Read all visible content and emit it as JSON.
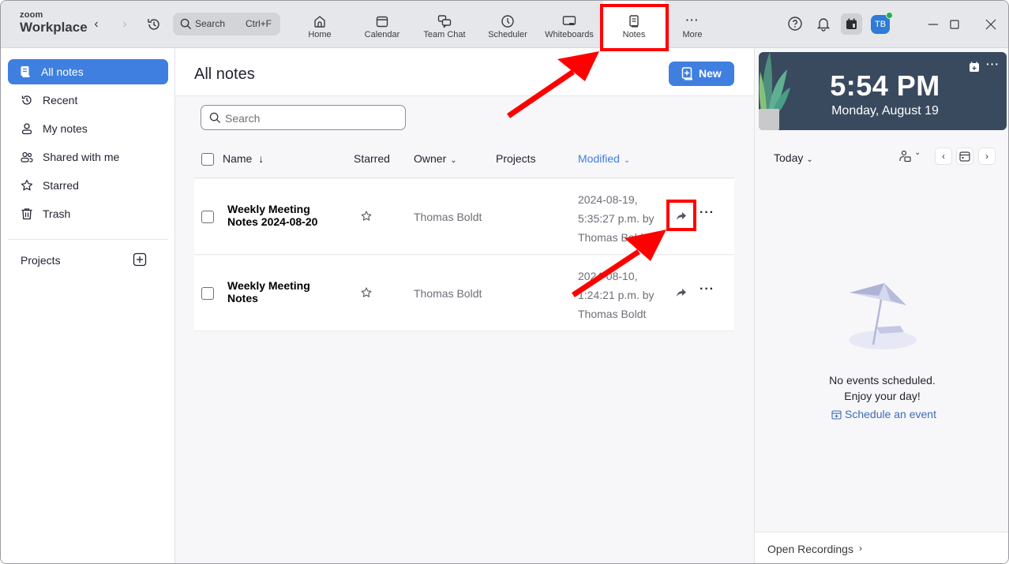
{
  "app": {
    "logo_line1": "zoom",
    "logo_line2": "Workplace"
  },
  "topbar": {
    "search_label": "Search",
    "search_shortcut": "Ctrl+F",
    "tabs": [
      {
        "label": "Home",
        "icon": "home-icon"
      },
      {
        "label": "Calendar",
        "icon": "calendar-icon"
      },
      {
        "label": "Team Chat",
        "icon": "chat-icon"
      },
      {
        "label": "Scheduler",
        "icon": "clock-icon"
      },
      {
        "label": "Whiteboards",
        "icon": "whiteboard-icon"
      },
      {
        "label": "Notes",
        "icon": "notes-icon",
        "active": true
      },
      {
        "label": "More",
        "icon": "more-icon"
      }
    ],
    "avatar_initials": "TB",
    "presence_color": "#1fb34a"
  },
  "sidebar": {
    "items": [
      {
        "label": "All notes",
        "icon": "notes-icon",
        "active": true
      },
      {
        "label": "Recent",
        "icon": "history-icon"
      },
      {
        "label": "My notes",
        "icon": "person-icon"
      },
      {
        "label": "Shared with me",
        "icon": "people-icon"
      },
      {
        "label": "Starred",
        "icon": "star-icon"
      },
      {
        "label": "Trash",
        "icon": "trash-icon"
      }
    ],
    "projects_label": "Projects"
  },
  "main": {
    "title": "All notes",
    "new_button": "New",
    "search_placeholder": "Search",
    "columns": {
      "name": "Name",
      "name_sort": "↓",
      "starred": "Starred",
      "owner": "Owner",
      "projects": "Projects",
      "modified": "Modified"
    },
    "rows": [
      {
        "name": "Weekly Meeting Notes 2024-08-20",
        "owner": "Thomas Boldt",
        "modified_line1": "2024-08-19,",
        "modified_line2": "5:35:27 p.m. by",
        "modified_line3": "Thomas Boldt"
      },
      {
        "name": "Weekly Meeting Notes",
        "owner": "Thomas Boldt",
        "modified_line1": "2024-08-10,",
        "modified_line2": "1:24:21 p.m. by",
        "modified_line3": "Thomas Boldt"
      }
    ]
  },
  "rightpanel": {
    "time": "5:54 PM",
    "date": "Monday, August 19",
    "today_label": "Today",
    "empty_line1": "No events scheduled.",
    "empty_line2": "Enjoy your day!",
    "schedule_link": "Schedule an event",
    "open_recordings": "Open Recordings"
  },
  "colors": {
    "accent": "#3f7fe0",
    "annotation": "#ff0000",
    "clock_card": "#394a5f"
  }
}
